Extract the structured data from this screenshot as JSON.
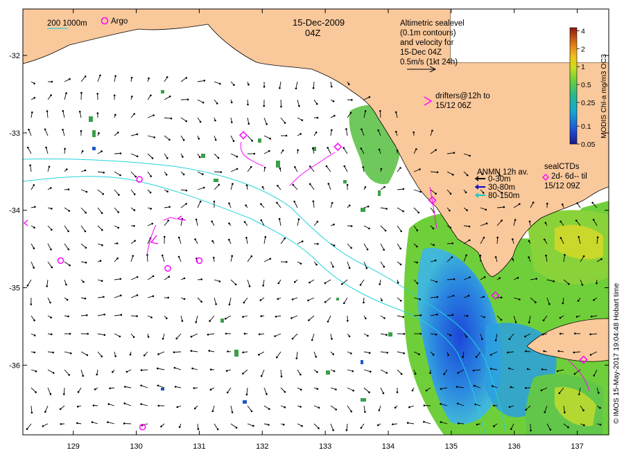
{
  "header": {
    "date": "15-Dec-2009",
    "time": "04Z"
  },
  "legend_topleft": {
    "isobath_label": "200  1000m",
    "argo_label": "Argo"
  },
  "altimetry_note": {
    "lines": [
      "Altimetric sealevel",
      "(0.1m contours)",
      "and velocity for",
      "15-Dec 04Z",
      "0.5m/s (1kt 24h)"
    ]
  },
  "drifters_note": {
    "lines": [
      "drifters@12h to",
      "15/12 06Z"
    ]
  },
  "anmn_legend": {
    "title": "ANMN 12h av.",
    "items": [
      {
        "label": "0-30m",
        "color": "#000000"
      },
      {
        "label": "30-80m",
        "color": "#0000cc"
      },
      {
        "label": "80-150m",
        "color": "#00cccc"
      }
    ]
  },
  "sealctd_legend": {
    "lines": [
      "sealCTDs",
      "2d- 6d-- til",
      "15/12 09Z"
    ]
  },
  "colorbar": {
    "label": "MODIS Chl-a mg/m3 OC3",
    "ticks": [
      "4",
      "2",
      "1",
      "0.5",
      "0.25",
      "0.1",
      "0.05"
    ]
  },
  "credit": "© IMOS 15-May-2017 19:04:48 Hobart time",
  "axes": {
    "x_ticks": [
      "129",
      "130",
      "131",
      "132",
      "133",
      "134",
      "135",
      "136",
      "137"
    ],
    "y_ticks": [
      "-32",
      "-33",
      "-34",
      "-35",
      "-36"
    ],
    "lon_range": [
      128.2,
      137.5
    ],
    "lat_range": [
      -36.9,
      -31.4
    ]
  },
  "argo_floats": [
    {
      "lon": 130.05,
      "lat": -33.6
    },
    {
      "lon": 128.8,
      "lat": -34.65
    },
    {
      "lon": 130.5,
      "lat": -34.75
    },
    {
      "lon": 131.0,
      "lat": -34.65
    },
    {
      "lon": 130.1,
      "lat": -36.8
    }
  ],
  "seal_ctds": [
    {
      "lon": 131.7,
      "lat": -33.03
    },
    {
      "lon": 133.2,
      "lat": -33.18
    },
    {
      "lon": 134.7,
      "lat": -33.87
    },
    {
      "lon": 135.7,
      "lat": -35.1
    },
    {
      "lon": 137.1,
      "lat": -35.93
    }
  ],
  "colors": {
    "land": "#f9c89b",
    "ocean": "#ffffff",
    "isobath": "#22d3d9",
    "marker": "#ff00ff",
    "vector": "#000000"
  }
}
